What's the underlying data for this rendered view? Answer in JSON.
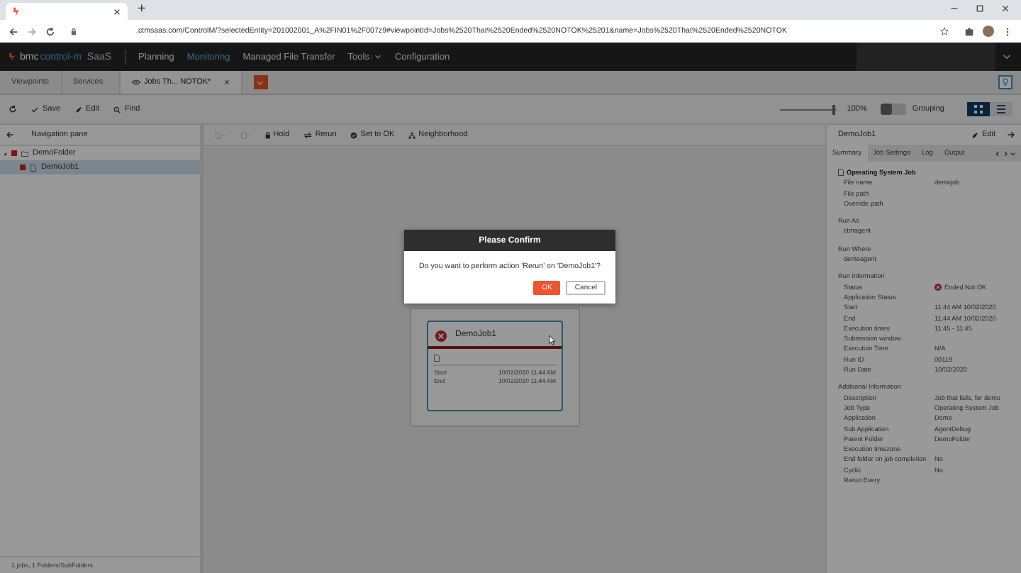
{
  "browser": {
    "url": ".ctmsaas.com/ControlM/?selectedEntity=201002001_A%2FIN01%2F007z9#viewpointId=Jobs%2520That%2520Ended%2520NOTOK%25201&name=Jobs%2520That%2520Ended%2520NOTOK",
    "new_tab": "+"
  },
  "app_header": {
    "logo_brand": "bmc",
    "logo_product": "control-m",
    "logo_suffix": "SaaS",
    "nav": [
      {
        "label": "Planning",
        "selected": false,
        "has_menu": false
      },
      {
        "label": "Monitoring",
        "selected": true,
        "has_menu": false
      },
      {
        "label": "Managed File Transfer",
        "selected": false,
        "has_menu": false
      },
      {
        "label": "Tools",
        "selected": false,
        "has_menu": true
      },
      {
        "label": "Configuration",
        "selected": false,
        "has_menu": false
      }
    ]
  },
  "view_tabs": [
    {
      "label": "Viewpoints",
      "selected": false,
      "kind": "plain"
    },
    {
      "label": "Services",
      "selected": false,
      "kind": "plain"
    },
    {
      "label": "Jobs Th... NOTOK*",
      "selected": true,
      "kind": "viewpoint"
    }
  ],
  "toolbar": {
    "actions": [
      "Save",
      "Edit",
      "Find"
    ],
    "zoom": {
      "level": 0.95,
      "reading": "100%"
    },
    "grouping": {
      "label": "Grouping",
      "on": false
    },
    "views": [
      {
        "kind": "grid",
        "selected": true
      },
      {
        "kind": "list",
        "selected": false
      }
    ]
  },
  "nav_pane": {
    "title": "Navigation pane",
    "tree": [
      {
        "label": "DemoFolder",
        "kind": "folder",
        "expanded": true,
        "selected": false,
        "children": [
          {
            "label": "DemoJob1",
            "kind": "job",
            "selected": true
          }
        ]
      }
    ]
  },
  "job_actions": [
    {
      "kind": "new",
      "disabled": true
    },
    {
      "kind": "copy",
      "disabled": true
    },
    {
      "kind": "hold",
      "label": "Hold",
      "disabled": false
    },
    {
      "kind": "rerun",
      "label": "Rerun",
      "disabled": false
    },
    {
      "kind": "ok",
      "label": "Set to OK",
      "disabled": false
    },
    {
      "kind": "neighborhood",
      "label": "Neighborhood",
      "disabled": false
    }
  ],
  "job_node": {
    "name": "DemoJob1",
    "failed": true,
    "rows": [
      {
        "label": "Start",
        "value": "10/02/2020 11:44 AM"
      },
      {
        "label": "End",
        "value": "10/02/2020 11:44 AM"
      }
    ]
  },
  "details": {
    "title": "DemoJob1",
    "edit": "Edit",
    "tabs": [
      {
        "label": "Summary",
        "selected": true
      },
      {
        "label": "Job Settings",
        "selected": false
      },
      {
        "label": "Log",
        "selected": false
      },
      {
        "label": "Output",
        "selected": false
      }
    ],
    "sections": [
      {
        "title": "Operating System Job",
        "kind": "job",
        "rows": [
          {
            "label": "File name",
            "value": "demojob"
          },
          {
            "label": "File path",
            "value": null
          },
          {
            "label": "Override path",
            "value": null
          }
        ]
      },
      {
        "title": "Run As",
        "kind": "plain",
        "rows": [
          {
            "label": "ctmagent",
            "value": null
          }
        ]
      },
      {
        "title": "Run Where",
        "kind": "plain",
        "rows": [
          {
            "label": "demoagent",
            "value": null
          }
        ]
      },
      {
        "title": "Run Information",
        "kind": "plain",
        "rows": [
          {
            "label": "Status",
            "value": "Ended Not OK",
            "kind": "status"
          },
          {
            "label": "Application Status",
            "value": null
          },
          {
            "label": "Start",
            "value": "11:44 AM 10/02/2020"
          },
          {
            "label": "End",
            "value": "11:44 AM 10/02/2020"
          },
          {
            "label": "Execution times",
            "value": "11:45 - 11:45"
          },
          {
            "label": "Submission window",
            "value": null
          },
          {
            "label": "Execution Time",
            "value": "N/A"
          },
          {
            "label": "Run ID",
            "value": "00119"
          },
          {
            "label": "Run Date",
            "value": "10/02/2020"
          }
        ]
      },
      {
        "title": "Additional Information",
        "kind": "plain",
        "rows": [
          {
            "label": "Description",
            "value": "Job that fails, for demo"
          },
          {
            "label": "Job Type",
            "value": "Operating System Job"
          },
          {
            "label": "Application",
            "value": "Demo"
          },
          {
            "label": "Sub Application",
            "value": "AgentDebug"
          },
          {
            "label": "Parent Folder",
            "value": "DemoFolder"
          },
          {
            "label": "Execution timezone",
            "value": null
          },
          {
            "label": "End folder on job completion",
            "value": "No"
          },
          {
            "label": "Cyclic",
            "value": "No"
          },
          {
            "label": "Rerun Every",
            "value": null
          }
        ]
      }
    ]
  },
  "status_bar": "1 jobs, 1 Folders/SubFolders",
  "dialog": {
    "title": "Please Confirm",
    "message": "Do you want to perform action 'Rerun' on 'DemoJob1'?",
    "buttons": [
      {
        "label": "OK",
        "kind": "primary"
      },
      {
        "label": "Cancel",
        "kind": "secondary"
      }
    ]
  }
}
